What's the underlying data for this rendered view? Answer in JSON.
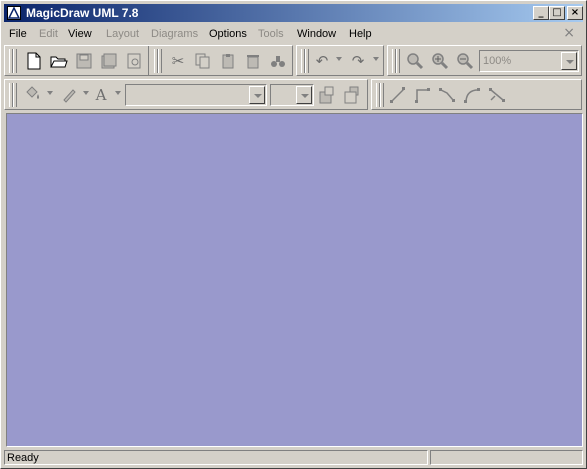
{
  "window": {
    "title": "MagicDraw UML 7.8"
  },
  "title_buttons": {
    "minimize": "_",
    "maximize": "□",
    "close": "×"
  },
  "menu": {
    "items": [
      {
        "label": "File",
        "enabled": true
      },
      {
        "label": "Edit",
        "enabled": false
      },
      {
        "label": "View",
        "enabled": true
      },
      {
        "label": "Layout",
        "enabled": false
      },
      {
        "label": "Diagrams",
        "enabled": false
      },
      {
        "label": "Options",
        "enabled": true
      },
      {
        "label": "Tools",
        "enabled": false
      },
      {
        "label": "Window",
        "enabled": true
      },
      {
        "label": "Help",
        "enabled": true
      }
    ],
    "close_glyph": "×"
  },
  "toolbar": {
    "zoom_value": "100%",
    "font_glyph": "A",
    "icons": [
      "new-file",
      "open",
      "save",
      "save-all",
      "print-preview",
      "cut",
      "copy",
      "paste",
      "delete",
      "find",
      "undo",
      "redo",
      "zoom-in",
      "zoom-plus",
      "zoom-out",
      "fill-color",
      "pen-color",
      "font",
      "bring-front",
      "send-back",
      "line-straight",
      "line-rect",
      "line-oblique",
      "line-curve",
      "line-split"
    ]
  },
  "status": {
    "text": "Ready"
  },
  "colors": {
    "canvas": "#9999cc",
    "title_start": "#0a246a",
    "title_end": "#a6caf0"
  }
}
